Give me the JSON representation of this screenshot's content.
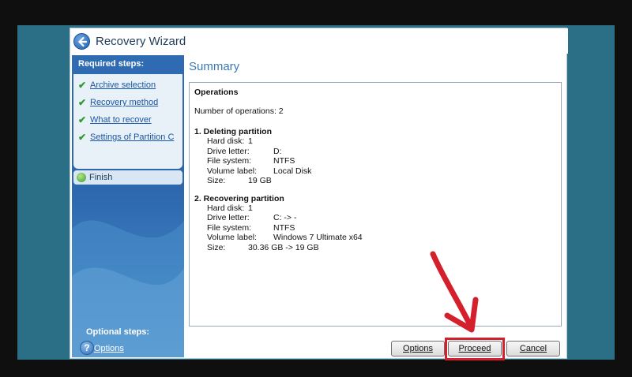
{
  "window": {
    "title": "Recovery Wizard"
  },
  "sidebar": {
    "required_heading": "Required steps:",
    "steps": [
      {
        "label": "Archive selection",
        "done": true
      },
      {
        "label": "Recovery method",
        "done": true
      },
      {
        "label": "What to recover",
        "done": true
      },
      {
        "label": "Settings of Partition C",
        "done": true
      }
    ],
    "current_step": "Finish",
    "optional_heading": "Optional steps:",
    "optional_link": "Options"
  },
  "main": {
    "title": "Summary",
    "operations_heading": "Operations",
    "number_of_operations": "Number of operations: 2",
    "sections": [
      {
        "heading": "1. Deleting partition",
        "rows": [
          {
            "key": "Hard disk:",
            "value": "1"
          },
          {
            "key": "Drive letter:",
            "value": "D:"
          },
          {
            "key": "File system:",
            "value": "NTFS"
          },
          {
            "key": "Volume label:",
            "value": "Local Disk"
          },
          {
            "key": "Size:",
            "value": "19 GB"
          }
        ]
      },
      {
        "heading": "2. Recovering partition",
        "rows": [
          {
            "key": "Hard disk:",
            "value": "1"
          },
          {
            "key": "Drive letter:",
            "value": "C: -> -"
          },
          {
            "key": "File system:",
            "value": "NTFS"
          },
          {
            "key": "Volume label:",
            "value": "Windows 7 Ultimate x64"
          },
          {
            "key": "Size:",
            "value": "30.36 GB -> 19 GB"
          }
        ]
      }
    ]
  },
  "footer": {
    "options_label": "Options",
    "proceed_label": "Proceed",
    "cancel_label": "Cancel",
    "help_icon": "?"
  },
  "colors": {
    "accent": "#3b78b5",
    "highlight": "#d4202c",
    "desktop": "#2a6f86"
  }
}
